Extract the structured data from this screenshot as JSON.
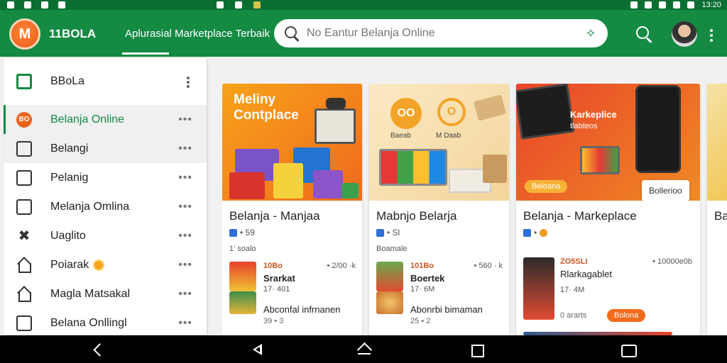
{
  "status_bar": {
    "time": "13:20"
  },
  "app": {
    "logo_text": "M",
    "name": "11BOLA",
    "tab_label": "Aplurasial Marketplace Terbaik"
  },
  "search": {
    "placeholder": "No Eantur Belanja Online"
  },
  "sidebar": {
    "header": "BBoLa",
    "items": [
      {
        "label": "Belanja Online",
        "badge": "BO"
      },
      {
        "label": "Belangi"
      },
      {
        "label": "Pelanig"
      },
      {
        "label": "Melanja Omlina"
      },
      {
        "label": "Uaglito"
      },
      {
        "label": "Poiarak"
      },
      {
        "label": "Magla Matsakal"
      },
      {
        "label": "Belana Onllingl"
      }
    ]
  },
  "cards": [
    {
      "hero_title_1": "Meliny",
      "hero_title_2": "Contplace",
      "title": "Belanja - Manjaa",
      "meta": "• 59",
      "sub": "1’ soalo",
      "row1": {
        "tag": "10Bo",
        "name": "Srarkat",
        "price": "17· 401",
        "extra": "• 2/00 ·k"
      },
      "row2": {
        "name": "Abconfal infrnanen",
        "rating": "39 • 3"
      }
    },
    {
      "hero_badge_1": "OO",
      "hero_badge_2": "O",
      "hero_caption_1": "Baeab",
      "hero_caption_2": "M Daab",
      "title": "Mabnjo Belarja",
      "meta": "• Sl",
      "sub": "Boamale",
      "row1": {
        "tag": "101Bo",
        "name": "Boertek",
        "price": "17· 6M",
        "extra": "• 560 · k"
      },
      "row2": {
        "name": "Abonrbi bimaman",
        "rating": "25 • 2"
      }
    },
    {
      "hero_title_1": "Karkeplice",
      "hero_title_2": "tlabteos",
      "hero_button": "Beloana",
      "pill": "Bollerioo",
      "title": "Belanja - Markeplace",
      "meta": "•",
      "row1": {
        "tag": "ZO5SLI",
        "name": "Rlarkagablet",
        "price": "17· 4M",
        "extra": "• 10000e0b"
      },
      "row2": {
        "rating": "0 ararts",
        "button": "Bolona"
      }
    },
    {
      "title": "Ba"
    }
  ],
  "colors": {
    "primary": "#148a43",
    "accent": "#f08a24",
    "status": "#0a6e33"
  }
}
